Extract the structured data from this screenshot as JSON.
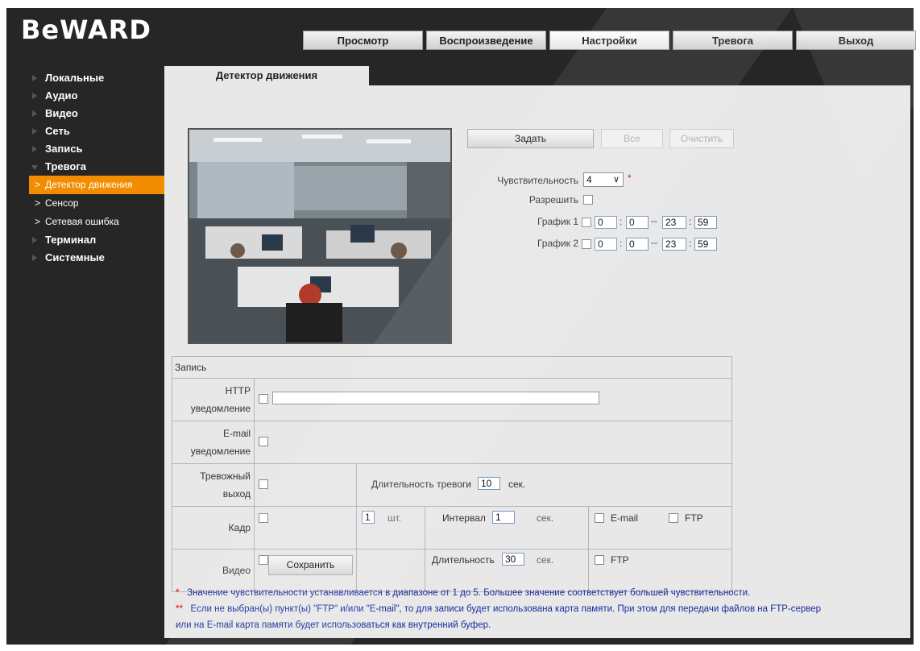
{
  "logo": "BeWARD",
  "tabs": [
    "Просмотр",
    "Воспроизведение",
    "Настройки",
    "Тревога",
    "Выход"
  ],
  "sidebar": {
    "items": [
      "Локальные",
      "Аудио",
      "Видео",
      "Сеть",
      "Запись",
      "Тревога"
    ],
    "sub_items": [
      "Детектор движения",
      "Сенсор",
      "Сетевая ошибка"
    ],
    "items_after": [
      "Терминал",
      "Системные"
    ]
  },
  "content_tab": "Детектор движения",
  "buttons": {
    "set": "Задать",
    "all": "Все",
    "clear": "Очистить",
    "save": "Сохранить"
  },
  "sensitivity": {
    "label": "Чувствительность",
    "value": "4",
    "required_mark": "*"
  },
  "enable_label": "Разрешить",
  "schedule1": {
    "label": "График 1",
    "start_h": "0",
    "start_m": "0",
    "end_h": "23",
    "end_m": "59"
  },
  "schedule2": {
    "label": "График 2",
    "start_h": "0",
    "start_m": "0",
    "end_h": "23",
    "end_m": "59"
  },
  "time_sep": "--",
  "record": {
    "title": "Запись",
    "http_label": "HTTP уведомление",
    "email_label": "E-mail уведомление",
    "alarm_out_label": "Тревожный выход",
    "alarm_duration_label": "Длительность тревоги",
    "alarm_duration_value": "10",
    "sec": "сек.",
    "frame_label": "Кадр",
    "frame_count": "1",
    "pcs": "шт.",
    "interval_label": "Интервал",
    "interval_value": "1",
    "video_label": "Видео",
    "duration_label": "Длительность",
    "duration_value": "30",
    "email": "E-mail",
    "ftp": "FTP"
  },
  "notes": {
    "star1": "*",
    "note1": "Значение чувствительности устанавливается в диапазоне от 1 до 5. Большее значение соответствует большей чувствительности.",
    "star2": "**",
    "note2a": "Если не выбран(ы) пункт(ы) \"FTP\" и/или \"E-mail\", то для записи будет использована карта памяти. При этом для передачи файлов на FTP-сервер",
    "note2b": "или на E-mail карта памяти будет использоваться как внутренний буфер."
  },
  "colors": {
    "frame": "#262626",
    "content": "#e8e8e8",
    "accent": "#f28c00",
    "note": "#1a2c9c"
  }
}
